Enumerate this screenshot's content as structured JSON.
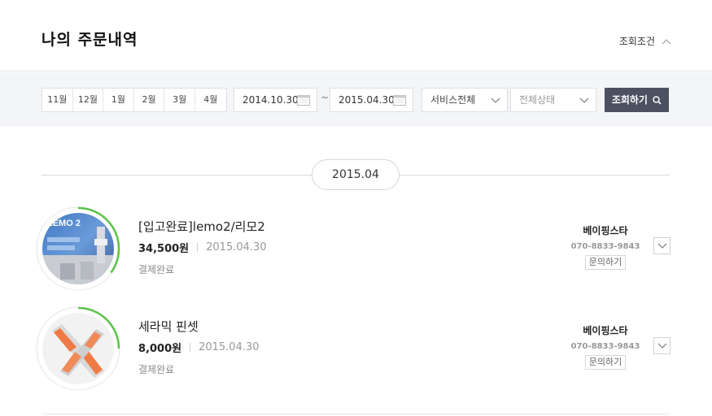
{
  "header": {
    "title": "나의 주문내역",
    "toggle_label": "조회조건"
  },
  "filter": {
    "months": [
      "11월",
      "12월",
      "1월",
      "2월",
      "3월",
      "4월"
    ],
    "start_date": "2014.10.30",
    "end_date": "2015.04.30",
    "date_separator": "~",
    "service_select": "서비스전체",
    "status_select": "전체상태",
    "search_label": "조회하기"
  },
  "group": {
    "label": "2015.04"
  },
  "orders": [
    {
      "name": "[입고완료]lemo2/리모2",
      "price": "34,500원",
      "date": "2015.04.30",
      "status": "결제완료",
      "seller": "베이핑스타",
      "phone": "070-8833-9843",
      "inquiry": "문의하기",
      "thumb_text": "LEMO 2",
      "progress": 0.35
    },
    {
      "name": "세라믹 핀셋",
      "price": "8,000원",
      "date": "2015.04.30",
      "status": "결제완료",
      "seller": "베이핑스타",
      "phone": "070-8833-9843",
      "inquiry": "문의하기",
      "progress": 0.25
    }
  ],
  "colors": {
    "progress_ring": "#5cc24a",
    "button_bg": "#4b5160",
    "page_bg_filter": "#f4f5f7"
  }
}
